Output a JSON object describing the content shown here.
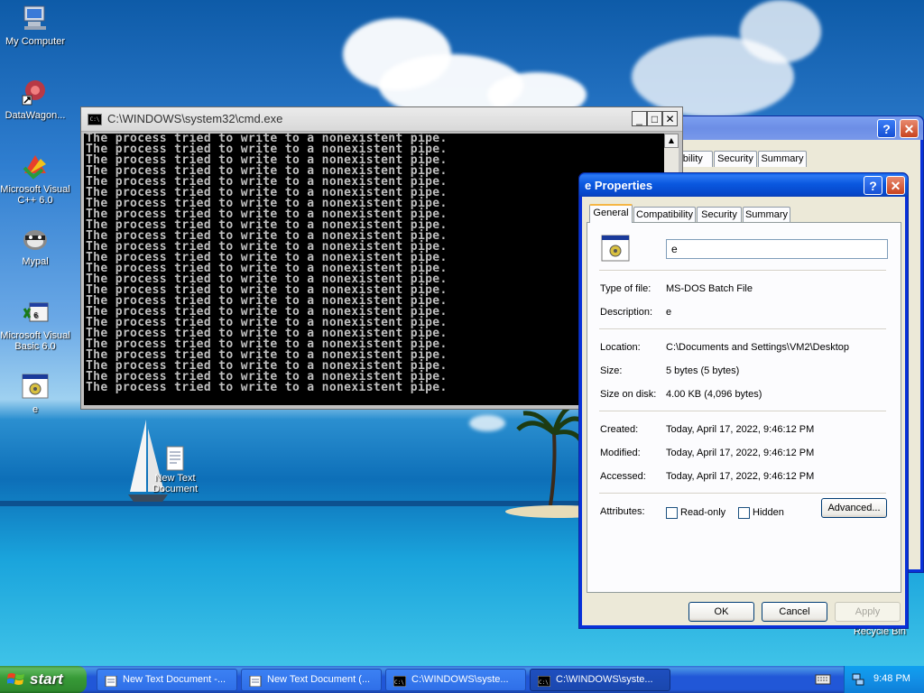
{
  "desktop": {
    "icons": [
      {
        "label": "My Computer",
        "icon": "my-computer-icon"
      },
      {
        "label": "DataWagon...",
        "icon": "datawagon-shortcut-icon"
      },
      {
        "label": "Microsoft Visual C++ 6.0",
        "icon": "visual-cpp-icon"
      },
      {
        "label": "Mypal",
        "icon": "mypal-raccoon-icon"
      },
      {
        "label": "Microsoft Visual Basic 6.0",
        "icon": "visual-basic-icon"
      },
      {
        "label": "e",
        "icon": "batch-file-icon"
      },
      {
        "label": "New Text Document",
        "icon": "text-document-icon"
      },
      {
        "label": "Recycle Bin",
        "icon": "recycle-bin-icon"
      }
    ]
  },
  "cmd_window": {
    "title": "C:\\WINDOWS\\system32\\cmd.exe",
    "icon": "cmd-icon",
    "lines": [
      "The process tried to write to a nonexistent pipe.",
      "The process tried to write to a nonexistent pipe.",
      "The process tried to write to a nonexistent pipe.",
      "The process tried to write to a nonexistent pipe.",
      "The process tried to write to a nonexistent pipe.",
      "The process tried to write to a nonexistent pipe.",
      "The process tried to write to a nonexistent pipe.",
      "The process tried to write to a nonexistent pipe.",
      "The process tried to write to a nonexistent pipe.",
      "The process tried to write to a nonexistent pipe.",
      "The process tried to write to a nonexistent pipe.",
      "The process tried to write to a nonexistent pipe.",
      "The process tried to write to a nonexistent pipe.",
      "The process tried to write to a nonexistent pipe.",
      "The process tried to write to a nonexistent pipe.",
      "The process tried to write to a nonexistent pipe.",
      "The process tried to write to a nonexistent pipe.",
      "The process tried to write to a nonexistent pipe.",
      "The process tried to write to a nonexistent pipe.",
      "The process tried to write to a nonexistent pipe.",
      "The process tried to write to a nonexistent pipe.",
      "The process tried to write to a nonexistent pipe.",
      "The process tried to write to a nonexistent pipe.",
      "The process tried to write to a nonexistent pipe."
    ],
    "buttons": {
      "minimize": "_",
      "maximize": "□",
      "close": "✕"
    }
  },
  "back_dialog": {
    "tabs": [
      "atibility",
      "Security",
      "Summary"
    ],
    "help": "?",
    "close": "✕"
  },
  "properties": {
    "title": "e Properties",
    "help": "?",
    "close": "✕",
    "tabs": [
      "General",
      "Compatibility",
      "Security",
      "Summary"
    ],
    "active_tab": "General",
    "file_name": "e",
    "file_icon": "batch-file-icon",
    "rows_type": [
      {
        "label": "Type of file:",
        "value": "MS-DOS Batch File"
      },
      {
        "label": "Description:",
        "value": "e"
      }
    ],
    "rows_loc": [
      {
        "label": "Location:",
        "value": "C:\\Documents and Settings\\VM2\\Desktop"
      },
      {
        "label": "Size:",
        "value": "5 bytes (5 bytes)"
      },
      {
        "label": "Size on disk:",
        "value": "4.00 KB (4,096 bytes)"
      }
    ],
    "rows_dates": [
      {
        "label": "Created:",
        "value": "Today, April 17, 2022, 9:46:12 PM"
      },
      {
        "label": "Modified:",
        "value": "Today, April 17, 2022, 9:46:12 PM"
      },
      {
        "label": "Accessed:",
        "value": "Today, April 17, 2022, 9:46:12 PM"
      }
    ],
    "attributes_label": "Attributes:",
    "readonly_label": "Read-only",
    "readonly_checked": false,
    "hidden_label": "Hidden",
    "hidden_checked": false,
    "advanced_label": "Advanced...",
    "ok_label": "OK",
    "cancel_label": "Cancel",
    "apply_label": "Apply",
    "apply_enabled": false
  },
  "taskbar": {
    "start_label": "start",
    "tasks": [
      {
        "label": "New Text Document -...",
        "icon": "notepad-icon"
      },
      {
        "label": "New Text Document (...",
        "icon": "notepad-icon"
      },
      {
        "label": "C:\\WINDOWS\\syste...",
        "icon": "cmd-icon"
      },
      {
        "label": "C:\\WINDOWS\\syste...",
        "icon": "cmd-icon"
      }
    ],
    "clock": "9:48 PM"
  }
}
